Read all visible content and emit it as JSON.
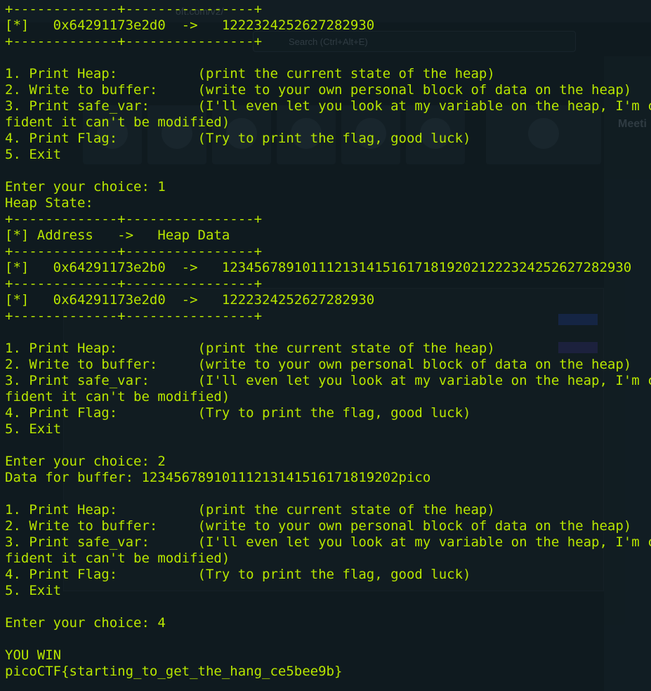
{
  "background": {
    "address_text": "oft.com/v2/",
    "search_placeholder": "Search (Ctrl+Alt+E)",
    "side_panel_title": "Meeti"
  },
  "terminal": {
    "text_color": "#b8e600",
    "background_color": "#0f1a1f",
    "lines": [
      "+-------------+----------------+",
      "[*]   0x64291173e2d0  ->   1222324252627282930",
      "+-------------+----------------+",
      "",
      "1. Print Heap:          (print the current state of the heap)",
      "2. Write to buffer:     (write to your own personal block of data on the heap)",
      "3. Print safe_var:      (I'll even let you look at my variable on the heap, I'm con",
      "fident it can't be modified)",
      "4. Print Flag:          (Try to print the flag, good luck)",
      "5. Exit",
      "",
      "Enter your choice: 1",
      "Heap State:",
      "+-------------+----------------+",
      "[*] Address   ->   Heap Data",
      "+-------------+----------------+",
      "[*]   0x64291173e2b0  ->   1234567891011121314151617181920212223242526272829​30",
      "+-------------+----------------+",
      "[*]   0x64291173e2d0  ->   1222324252627282930",
      "+-------------+----------------+",
      "",
      "1. Print Heap:          (print the current state of the heap)",
      "2. Write to buffer:     (write to your own personal block of data on the heap)",
      "3. Print safe_var:      (I'll even let you look at my variable on the heap, I'm con",
      "fident it can't be modified)",
      "4. Print Flag:          (Try to print the flag, good luck)",
      "5. Exit",
      "",
      "Enter your choice: 2",
      "Data for buffer: 1234567891011121314151617181920​2pico",
      "",
      "1. Print Heap:          (print the current state of the heap)",
      "2. Write to buffer:     (write to your own personal block of data on the heap)",
      "3. Print safe_var:      (I'll even let you look at my variable on the heap, I'm con",
      "fident it can't be modified)",
      "4. Print Flag:          (Try to print the flag, good luck)",
      "5. Exit",
      "",
      "Enter your choice: 4",
      "",
      "YOU WIN",
      "picoCTF{starting_to_get_the_hang_ce5bee9b}"
    ]
  }
}
